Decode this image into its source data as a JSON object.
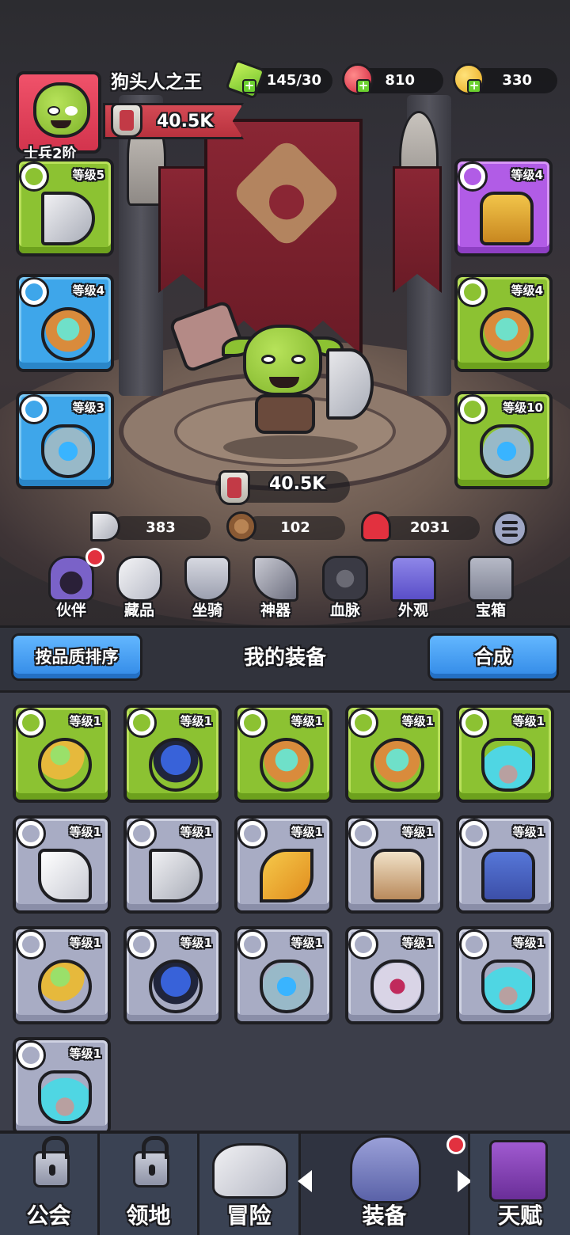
{
  "player": {
    "name": "狗头人之王",
    "rank": "士兵2阶",
    "power": "40.5K"
  },
  "resources": {
    "energy": "145/30",
    "gems": "810",
    "gold": "330"
  },
  "equipped": {
    "left": [
      {
        "name": "axe",
        "level": "等级5",
        "quality": "green"
      },
      {
        "name": "ring",
        "level": "等级4",
        "quality": "blue"
      },
      {
        "name": "amulet",
        "level": "等级3",
        "quality": "blue"
      }
    ],
    "right": [
      {
        "name": "armor",
        "level": "等级4",
        "quality": "purple"
      },
      {
        "name": "ring",
        "level": "等级4",
        "quality": "green"
      },
      {
        "name": "amulet",
        "level": "等级10",
        "quality": "green"
      }
    ]
  },
  "center_power": "40.5K",
  "stats": {
    "attack": "383",
    "defense": "102",
    "hp": "2031"
  },
  "menu": [
    "伙伴",
    "藏品",
    "坐骑",
    "神器",
    "血脉",
    "外观",
    "宝箱"
  ],
  "inventory": {
    "sort_button": "按品质排序",
    "title": "我的装备",
    "merge_button": "合成",
    "items": [
      {
        "icon": "ring-green-icon",
        "level": "等级1",
        "quality": "green"
      },
      {
        "icon": "ring-blue-icon",
        "level": "等级1",
        "quality": "green"
      },
      {
        "icon": "ring-teal-icon",
        "level": "等级1",
        "quality": "green"
      },
      {
        "icon": "ring-teal-icon",
        "level": "等级1",
        "quality": "green"
      },
      {
        "icon": "mask-teal-icon",
        "level": "等级1",
        "quality": "green"
      },
      {
        "icon": "hammer-icon",
        "level": "等级1",
        "quality": "gray"
      },
      {
        "icon": "axe-icon",
        "level": "等级1",
        "quality": "gray"
      },
      {
        "icon": "bow-icon",
        "level": "等级1",
        "quality": "gray"
      },
      {
        "icon": "leather-armor-icon",
        "level": "等级1",
        "quality": "gray"
      },
      {
        "icon": "blue-armor-icon",
        "level": "等级1",
        "quality": "gray"
      },
      {
        "icon": "ring-green-icon",
        "level": "等级1",
        "quality": "gray"
      },
      {
        "icon": "ring-blue-icon",
        "level": "等级1",
        "quality": "gray"
      },
      {
        "icon": "amulet-icon",
        "level": "等级1",
        "quality": "gray"
      },
      {
        "icon": "mask-pink-icon",
        "level": "等级1",
        "quality": "gray"
      },
      {
        "icon": "mask-teal-icon",
        "level": "等级1",
        "quality": "gray"
      },
      {
        "icon": "mask-teal-icon",
        "level": "等级1",
        "quality": "gray"
      }
    ]
  },
  "nav": [
    "公会",
    "领地",
    "冒险",
    "装备",
    "天赋"
  ],
  "colors": {
    "green": "#8cc232",
    "blue": "#3ea6ea",
    "purple": "#b15ce6",
    "gray": "#a8acc4",
    "accent_blue": "#3189e6",
    "red": "#e2313f"
  }
}
